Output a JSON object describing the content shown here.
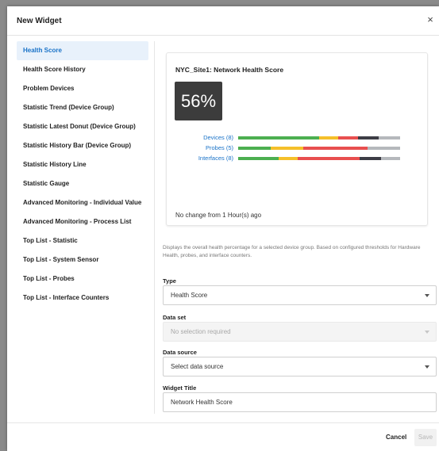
{
  "dialog": {
    "title": "New Widget",
    "close_icon": "×"
  },
  "sidebar": {
    "items": [
      {
        "label": "Health Score",
        "active": true
      },
      {
        "label": "Health Score History"
      },
      {
        "label": "Problem Devices"
      },
      {
        "label": "Statistic Trend (Device Group)"
      },
      {
        "label": "Statistic Latest Donut (Device Group)"
      },
      {
        "label": "Statistic History Bar (Device Group)"
      },
      {
        "label": "Statistic History Line"
      },
      {
        "label": "Statistic Gauge"
      },
      {
        "label": "Advanced Monitoring - Individual Value"
      },
      {
        "label": "Advanced Monitoring - Process List"
      },
      {
        "label": "Top List - Statistic"
      },
      {
        "label": "Top List - System Sensor"
      },
      {
        "label": "Top List - Probes"
      },
      {
        "label": "Top List - Interface Counters"
      }
    ]
  },
  "preview": {
    "title": "NYC_Site1: Network Health Score",
    "score": "56%",
    "rows": [
      {
        "label": "Devices (8)",
        "segments": [
          {
            "color": "#4caf50",
            "share": 0.5
          },
          {
            "color": "#f5c02a",
            "share": 0.12
          },
          {
            "color": "#e84f4f",
            "share": 0.12
          },
          {
            "color": "#3d3d46",
            "share": 0.13
          },
          {
            "color": "#b5b8bc",
            "share": 0.13
          }
        ]
      },
      {
        "label": "Probes (5)",
        "segments": [
          {
            "color": "#4caf50",
            "share": 0.2
          },
          {
            "color": "#f5c02a",
            "share": 0.2
          },
          {
            "color": "#e84f4f",
            "share": 0.4
          },
          {
            "color": "#b5b8bc",
            "share": 0.2
          }
        ]
      },
      {
        "label": "Interfaces (8)",
        "segments": [
          {
            "color": "#4caf50",
            "share": 0.25
          },
          {
            "color": "#f5c02a",
            "share": 0.12
          },
          {
            "color": "#e84f4f",
            "share": 0.38
          },
          {
            "color": "#3d3d46",
            "share": 0.13
          },
          {
            "color": "#b5b8bc",
            "share": 0.12
          }
        ]
      }
    ],
    "note": "No change from 1 Hour(s) ago"
  },
  "description": "Displays the overall health percentage for a selected device group. Based on configured thresholds for Hardware Health, probes, and interface counters.",
  "form": {
    "type_label": "Type",
    "type_value": "Health Score",
    "dataset_label": "Data set",
    "dataset_value": "No selection required",
    "datasource_label": "Data source",
    "datasource_value": "Select data source",
    "title_label": "Widget Title",
    "title_value": "Network Health Score"
  },
  "footer": {
    "cancel_label": "Cancel",
    "save_label": "Save"
  },
  "colors": {
    "accent": "#1a73c8",
    "active_bg": "#e8f1fb",
    "score_bg": "#3c3c3c"
  }
}
